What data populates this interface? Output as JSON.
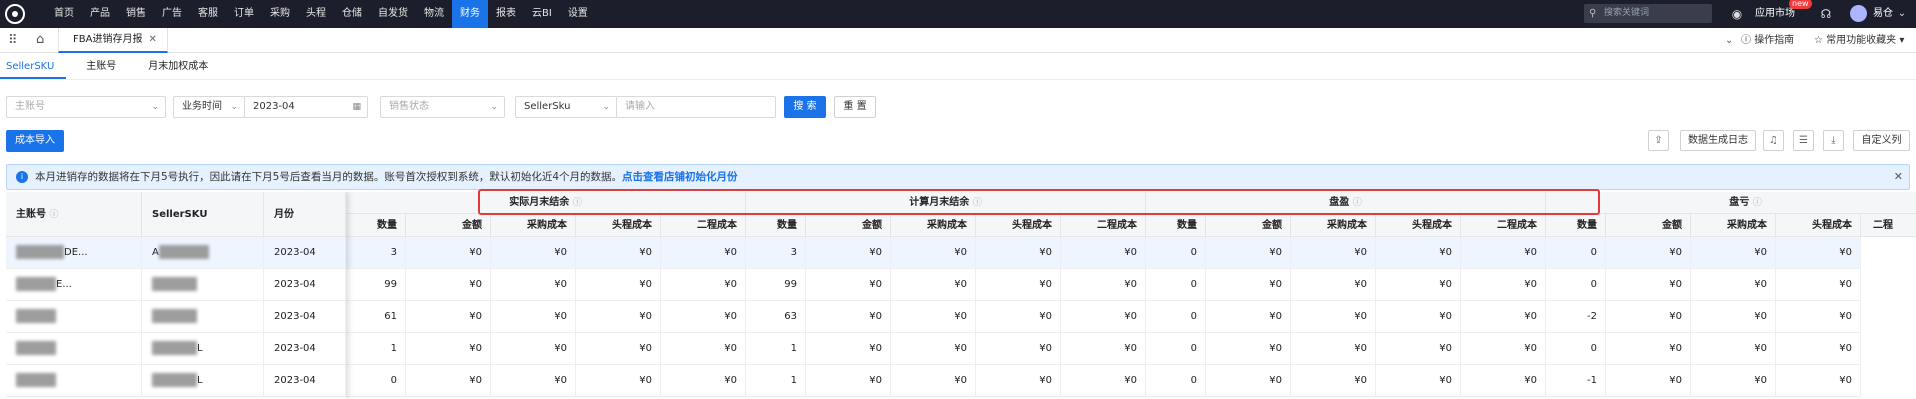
{
  "top_nav": {
    "menu": [
      "首页",
      "产品",
      "销售",
      "广告",
      "客服",
      "订单",
      "采购",
      "头程",
      "仓储",
      "自发货",
      "物流",
      "财务",
      "报表",
      "云BI",
      "设置"
    ],
    "active": "财务",
    "search_placeholder": "搜索关键词",
    "app_market": "应用市场",
    "new_badge": "new",
    "user_name": "易仓"
  },
  "tab_bar": {
    "page_tab": "FBA进销存月报",
    "help": "操作指南",
    "favorites": "常用功能收藏夹"
  },
  "sub_tabs": [
    "SellerSKU",
    "主账号",
    "月末加权成本"
  ],
  "filters": {
    "account_placeholder": "主账号",
    "time_type": "业务时间",
    "month_value": "2023-04",
    "sales_status_placeholder": "销售状态",
    "sku_type": "SellerSku",
    "keyword_placeholder": "请输入",
    "search_label": "搜 索",
    "reset_label": "重 置"
  },
  "toolbar": {
    "import_label": "成本导入",
    "log_label": "数据生成日志",
    "custom_columns_label": "自定义列"
  },
  "notice": {
    "text": "本月进销存的数据将在下月5号执行，因此请在下月5号后查看当月的数据。账号首次授权到系统，默认初始化近4个月的数据。",
    "link": "点击查看店铺初始化月份"
  },
  "table": {
    "fixed_headers": [
      "主账号",
      "SellerSKU",
      "月份"
    ],
    "groups": [
      "实际月末结余",
      "计算月末结余",
      "盘盈",
      "盘亏"
    ],
    "sub_headers": [
      "数量",
      "金额",
      "采购成本",
      "头程成本",
      "二程成本"
    ],
    "last_partial_header": "二程",
    "rows": [
      {
        "account_suffix": "DE...",
        "sku_prefix": "A",
        "month": "2023-04",
        "groups": [
          [
            "3",
            "¥0",
            "¥0",
            "¥0",
            "¥0"
          ],
          [
            "3",
            "¥0",
            "¥0",
            "¥0",
            "¥0"
          ],
          [
            "0",
            "¥0",
            "¥0",
            "¥0",
            "¥0"
          ],
          [
            "0",
            "¥0",
            "¥0",
            "¥0"
          ]
        ]
      },
      {
        "account_suffix": "E...",
        "sku_prefix": "",
        "month": "2023-04",
        "groups": [
          [
            "99",
            "¥0",
            "¥0",
            "¥0",
            "¥0"
          ],
          [
            "99",
            "¥0",
            "¥0",
            "¥0",
            "¥0"
          ],
          [
            "0",
            "¥0",
            "¥0",
            "¥0",
            "¥0"
          ],
          [
            "0",
            "¥0",
            "¥0",
            "¥0"
          ]
        ]
      },
      {
        "account_suffix": "",
        "sku_prefix": "",
        "month": "2023-04",
        "groups": [
          [
            "61",
            "¥0",
            "¥0",
            "¥0",
            "¥0"
          ],
          [
            "63",
            "¥0",
            "¥0",
            "¥0",
            "¥0"
          ],
          [
            "0",
            "¥0",
            "¥0",
            "¥0",
            "¥0"
          ],
          [
            "-2",
            "¥0",
            "¥0",
            "¥0"
          ]
        ]
      },
      {
        "account_suffix": "",
        "sku_prefix": "",
        "sku_suffix": "L",
        "month": "2023-04",
        "groups": [
          [
            "1",
            "¥0",
            "¥0",
            "¥0",
            "¥0"
          ],
          [
            "1",
            "¥0",
            "¥0",
            "¥0",
            "¥0"
          ],
          [
            "0",
            "¥0",
            "¥0",
            "¥0",
            "¥0"
          ],
          [
            "0",
            "¥0",
            "¥0",
            "¥0"
          ]
        ]
      },
      {
        "account_suffix": "",
        "sku_prefix": "",
        "sku_suffix": "L",
        "month": "2023-04",
        "groups": [
          [
            "0",
            "¥0",
            "¥0",
            "¥0",
            "¥0"
          ],
          [
            "1",
            "¥0",
            "¥0",
            "¥0",
            "¥0"
          ],
          [
            "0",
            "¥0",
            "¥0",
            "¥0",
            "¥0"
          ],
          [
            "-1",
            "¥0",
            "¥0",
            "¥0"
          ]
        ]
      }
    ]
  }
}
